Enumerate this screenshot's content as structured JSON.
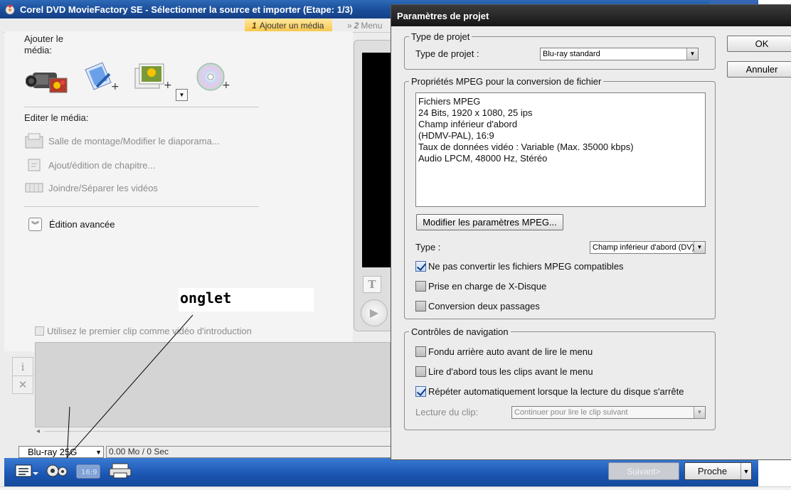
{
  "app": {
    "title": "Corel DVD MovieFactory SE - Sélectionner la source et importer (Etape: 1/3)",
    "steps": {
      "step1_number": "1",
      "step1_label": "Ajouter un média",
      "step2_number": "2",
      "step2_label": "Menu"
    },
    "add_media_label": "Ajouter le média:",
    "edit_media_label": "Editer le média:",
    "edit_items": [
      "Salle de montage/Modifier le diaporama...",
      "Ajout/édition de chapitre...",
      "Joindre/Séparer les vidéos"
    ],
    "advanced_edit_label": "Édition avancée",
    "annotation_text": "onglet",
    "intro_clip_label": "Utilisez le premier clip comme vidéo d'introduction",
    "disc_type": "Blu-ray 25G",
    "disc_usage": "0.00 Mo / 0 Sec",
    "next_button": "Suivant>",
    "close_button": "Proche",
    "preview_title_glyph": "T",
    "side_info_glyph": "i",
    "side_delete_glyph": "✕"
  },
  "dialog": {
    "title": "Paramètres de projet",
    "ok_button": "OK",
    "cancel_button": "Annuler",
    "project_type": {
      "legend": "Type de projet",
      "label": "Type de projet :",
      "value": "Blu-ray standard"
    },
    "mpeg": {
      "legend": "Propriétés MPEG pour la conversion de fichier",
      "info_lines": [
        "Fichiers MPEG",
        "24 Bits, 1920 x 1080, 25 ips",
        "Champ inférieur d'abord",
        "(HDMV-PAL),  16:9",
        "Taux de données vidéo : Variable  (Max. 35000 kbps)",
        "Audio LPCM, 48000 Hz, Stéréo"
      ],
      "modify_button": "Modifier les paramètres MPEG...",
      "type_label": "Type :",
      "type_value": "Champ inférieur d'abord (DV)",
      "no_convert_label": "Ne pas convertir les fichiers MPEG compatibles",
      "no_convert_checked": true,
      "xdisc_label": "Prise en charge de X-Disque",
      "xdisc_checked": false,
      "two_pass_label": "Conversion deux passages",
      "two_pass_checked": false
    },
    "navigation": {
      "legend": "Contrôles de navigation",
      "fade_label": "Fondu arrière auto avant de lire le menu",
      "fade_checked": false,
      "play_all_label": "Lire d'abord tous les clips avant le menu",
      "play_all_checked": false,
      "repeat_label": "Répéter automatiquement lorsque la lecture du disque s'arrête",
      "repeat_checked": true,
      "clip_playback_label": "Lecture du clip:",
      "clip_playback_value": "Continuer pour lire le clip suivant"
    }
  },
  "colors": {
    "titlebar_blue": "#1a4d99",
    "dialog_title_bg": "#161616",
    "step_highlight": "#f7c64b",
    "checkbox_check": "#0f3d86"
  }
}
